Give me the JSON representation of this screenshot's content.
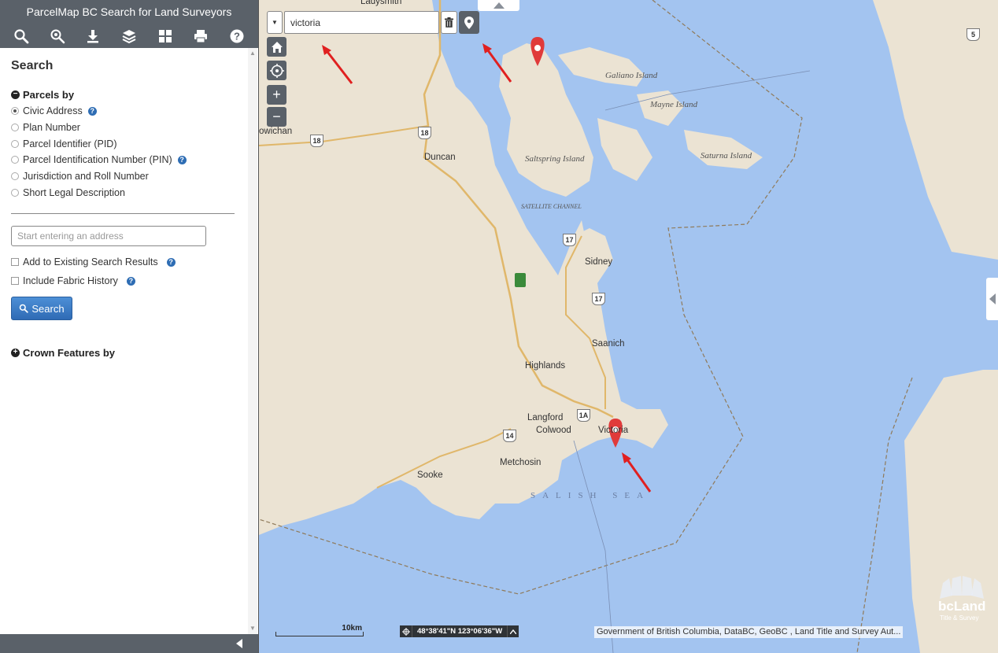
{
  "app": {
    "title": "ParcelMap BC Search for Land Surveyors"
  },
  "toolbar": {
    "icons": [
      "search-icon",
      "advanced-search-icon",
      "download-icon",
      "layers-icon",
      "grid-icon",
      "print-icon",
      "help-icon"
    ]
  },
  "search_panel": {
    "heading": "Search",
    "parcels_section_label": "Parcels by",
    "parcel_options": [
      {
        "label": "Civic Address",
        "checked": true,
        "help": true
      },
      {
        "label": "Plan Number",
        "checked": false,
        "help": false
      },
      {
        "label": "Parcel Identifier (PID)",
        "checked": false,
        "help": false
      },
      {
        "label": "Parcel Identification Number (PIN)",
        "checked": false,
        "help": true
      },
      {
        "label": "Jurisdiction and Roll Number",
        "checked": false,
        "help": false
      },
      {
        "label": "Short Legal Description",
        "checked": false,
        "help": false
      }
    ],
    "address_placeholder": "Start entering an address",
    "add_to_existing_label": "Add to Existing Search Results",
    "include_fabric_label": "Include Fabric History",
    "search_button_label": "Search",
    "crown_section_label": "Crown Features by"
  },
  "map": {
    "geocoder_value": "victoria",
    "scale_label": "10km",
    "coordinates": "48°38'41\"N 123°06'36\"W",
    "attribution": "Government of British Columbia, DataBC, GeoBC , Land Title and Survey Aut...",
    "logo_text": "bcLand",
    "logo_subtext": "Title & Survey",
    "labels": {
      "ladysmith": "Ladysmith",
      "cowichan": "owichan",
      "duncan": "Duncan",
      "saltspring": "Saltspring Island",
      "galiano": "Galiano Island",
      "mayne": "Mayne Island",
      "saturna": "Saturna Island",
      "satellite": "SATELLITE CHANNEL",
      "sidney": "Sidney",
      "saanich": "Saanich",
      "highlands": "Highlands",
      "langford": "Langford",
      "colwood": "Colwood",
      "victoria": "Victoria",
      "metchosin": "Metchosin",
      "sooke": "Sooke",
      "salish_sea": "SALISH SEA"
    },
    "highways": [
      "18",
      "18",
      "17",
      "17",
      "1A",
      "14",
      "5"
    ],
    "colors": {
      "water": "#a3c4f0",
      "land": "#ebe3d3",
      "marker": "#e03a3a",
      "arrow": "#e02020",
      "control": "#5a6169"
    }
  }
}
